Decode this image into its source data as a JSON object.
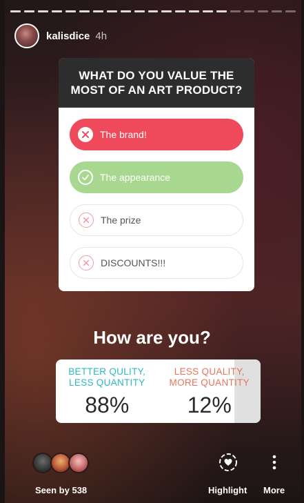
{
  "story": {
    "username": "kalisdice",
    "time": "4h"
  },
  "quiz": {
    "question": "WHAT DO YOU VALUE THE MOST OF AN ART PRODUCT?",
    "options": [
      {
        "label": "The brand!",
        "state": "selected-wrong"
      },
      {
        "label": "The appearance",
        "state": "correct"
      },
      {
        "label": "The prize",
        "state": "wrong"
      },
      {
        "label": "DISCOUNTS!!!",
        "state": "wrong"
      }
    ]
  },
  "poll": {
    "question": "How are you?",
    "left": {
      "label": "BETTER QULITY, LESS QUANTITY",
      "line1": "BETTER QULITY,",
      "line2": "LESS QUANTITY",
      "percent": "88%",
      "color": "#2bb8c4"
    },
    "right": {
      "label": "LESS QUALITY, MORE QUANTITY",
      "line1": "LESS QUALITY,",
      "line2": "MORE QUANTITY",
      "percent": "12%",
      "color": "#e8735a"
    }
  },
  "footer": {
    "seen_by": "Seen by 538",
    "highlight_label": "Highlight",
    "more_label": "More"
  },
  "icons": [
    "x-icon",
    "check-icon",
    "heart-icon",
    "more-vertical-icon"
  ],
  "colors": {
    "wrong": "#ef4a5b",
    "correct": "#a8d890"
  }
}
